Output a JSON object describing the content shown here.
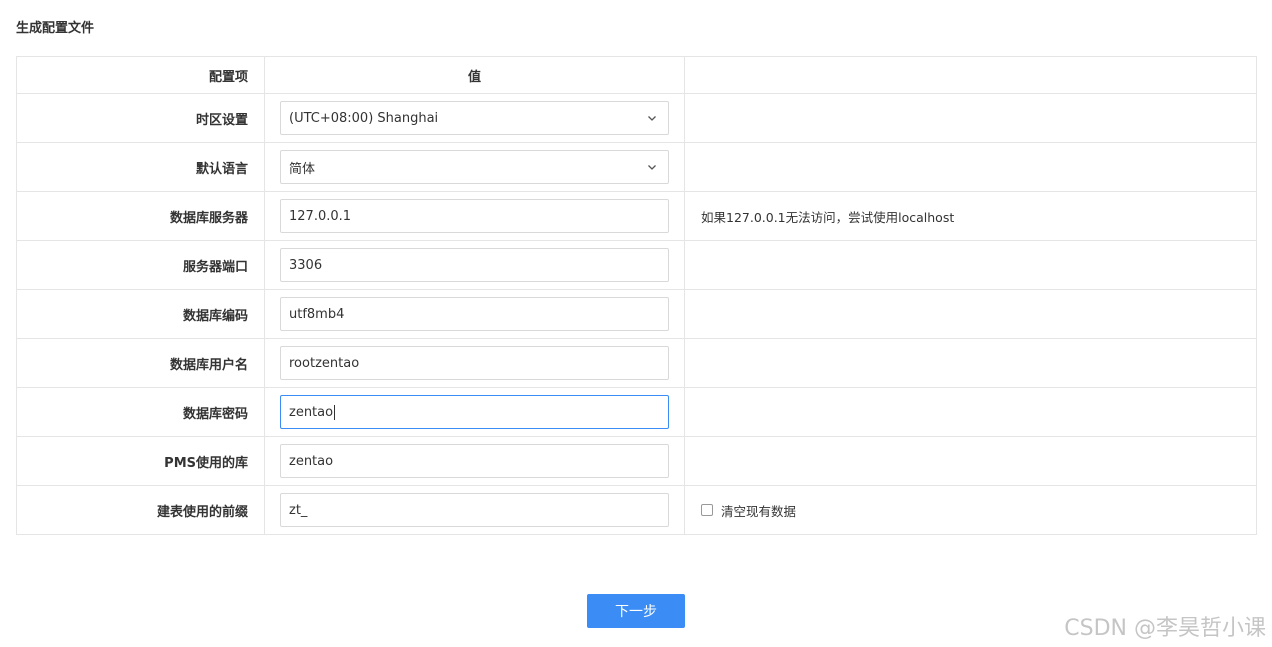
{
  "page": {
    "title": "生成配置文件"
  },
  "table": {
    "headers": {
      "label": "配置项",
      "value": "值",
      "note": ""
    },
    "rows": [
      {
        "label": "时区设置",
        "value": "(UTC+08:00) Shanghai",
        "note": ""
      },
      {
        "label": "默认语言",
        "value": "简体",
        "note": ""
      },
      {
        "label": "数据库服务器",
        "value": "127.0.0.1",
        "note": "如果127.0.0.1无法访问，尝试使用localhost"
      },
      {
        "label": "服务器端口",
        "value": "3306",
        "note": ""
      },
      {
        "label": "数据库编码",
        "value": "utf8mb4",
        "note": ""
      },
      {
        "label": "数据库用户名",
        "value": "rootzentao",
        "note": ""
      },
      {
        "label": "数据库密码",
        "value": "zentao",
        "note": ""
      },
      {
        "label": "PMS使用的库",
        "value": "zentao",
        "note": ""
      },
      {
        "label": "建表使用的前缀",
        "value": "zt_",
        "note": ""
      }
    ],
    "clear_data_checkbox": {
      "label": "清空现有数据",
      "checked": false
    }
  },
  "actions": {
    "next_label": "下一步"
  },
  "watermark": "CSDN @李昊哲小课",
  "colors": {
    "primary": "#3b8cf5",
    "border": "#e5e5e5",
    "focus_border": "#3b8cf5"
  },
  "icons": {
    "select_arrow": "chevron-down-icon"
  }
}
